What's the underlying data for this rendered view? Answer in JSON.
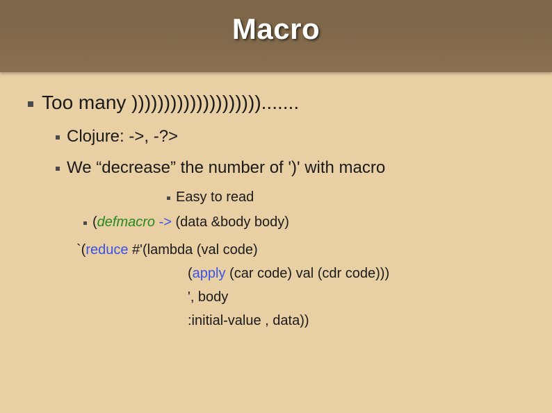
{
  "title": "Macro",
  "lvl1": "Too many )))))))))))))))))))).......",
  "lvl2a": "Clojure: ->, -?>",
  "lvl2b": "We “decrease” the number of ')' with macro",
  "lvl3a": "Easy to read",
  "code": {
    "l1_prefix": "(",
    "l1_macro": "defmacro",
    "l1_arrow": " -> ",
    "l1_rest": "(data &body body)",
    "l2_prefix": "`(",
    "l2_reduce": "reduce",
    "l2_rest": " #'(lambda (val code)",
    "l3_prefix": "(",
    "l3_apply": "apply",
    "l3_rest": " (car code) val (cdr code)))",
    "l4": "', body",
    "l5": ":initial-value , data))"
  }
}
